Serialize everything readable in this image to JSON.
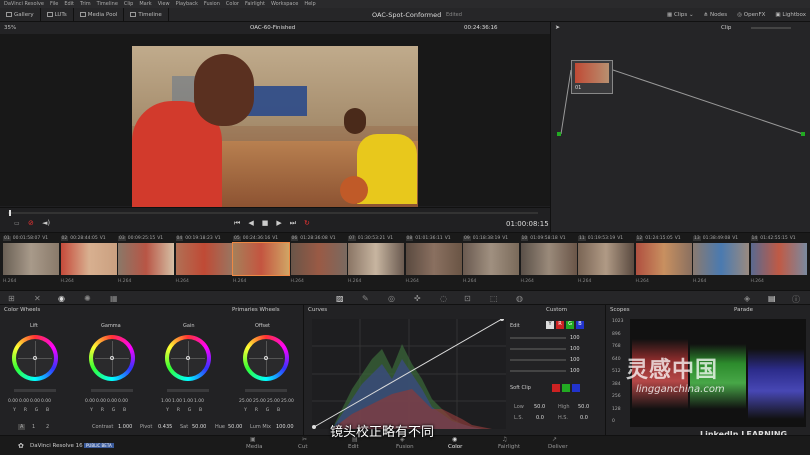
{
  "menu": [
    "DaVinci Resolve",
    "File",
    "Edit",
    "Trim",
    "Timeline",
    "Clip",
    "Mark",
    "View",
    "Playback",
    "Fusion",
    "Color",
    "Fairlight",
    "Workspace",
    "Help"
  ],
  "toolbar": {
    "gallery": "Gallery",
    "luts": "LUTs",
    "media_pool": "Media Pool",
    "timeline": "Timeline",
    "project_title": "OAC-Spot-Conformed",
    "edited": "Edited",
    "clips": "Clips",
    "nodes": "Nodes",
    "openfx": "OpenFX",
    "lightbox": "Lightbox"
  },
  "viewer": {
    "zoom": "35%",
    "clip_name": "OAC-60-Finished",
    "timecode_top": "00:24:36:16",
    "timecode": "01:00:08:15",
    "clip_mode": "Clip"
  },
  "node": {
    "label": "01"
  },
  "clips": [
    {
      "num": "01",
      "tc": "00:01:58:07",
      "track": "V1",
      "codec": "H.264",
      "bg": "linear-gradient(90deg,#6a6055,#a89a8a,#8a7a6a)"
    },
    {
      "num": "02",
      "tc": "00:28:44:05",
      "track": "V1",
      "codec": "H.264",
      "bg": "linear-gradient(90deg,#c54a3a,#d8b090,#caa080)"
    },
    {
      "num": "03",
      "tc": "00:09:25:15",
      "track": "V1",
      "codec": "H.264",
      "bg": "linear-gradient(90deg,#8a7868,#b85545,#d5c0a5)"
    },
    {
      "num": "04",
      "tc": "00:19:18:23",
      "track": "V1",
      "codec": "H.264",
      "bg": "linear-gradient(90deg,#b07055,#c04a35,#9a7560)"
    },
    {
      "num": "05",
      "tc": "00:24:36:16",
      "track": "V1",
      "codec": "H.264",
      "bg": "linear-gradient(90deg,#a5805a,#c45540,#d0a565)"
    },
    {
      "num": "06",
      "tc": "01:28:36:08",
      "track": "V1",
      "codec": "H.264",
      "bg": "linear-gradient(90deg,#6a5548,#9a5a45,#7a6a60)"
    },
    {
      "num": "07",
      "tc": "01:30:53:21",
      "track": "V1",
      "codec": "H.264",
      "bg": "linear-gradient(90deg,#8a7565,#c7b5a0,#6a5a50)"
    },
    {
      "num": "08",
      "tc": "01:01:36:11",
      "track": "V1",
      "codec": "H.264",
      "bg": "linear-gradient(90deg,#5a4a40,#8a7060,#6a5545)"
    },
    {
      "num": "09",
      "tc": "01:18:38:19",
      "track": "V1",
      "codec": "H.264",
      "bg": "linear-gradient(90deg,#6a5a50,#a09080,#7a6a5a)"
    },
    {
      "num": "10",
      "tc": "01:09:58:18",
      "track": "V1",
      "codec": "H.264",
      "bg": "linear-gradient(90deg,#5a5048,#9a8a7a,#6a5548)"
    },
    {
      "num": "11",
      "tc": "01:19:53:19",
      "track": "V1",
      "codec": "H.264",
      "bg": "linear-gradient(90deg,#7a6555,#b09a85,#5a4a40)"
    },
    {
      "num": "12",
      "tc": "01:24:15:05",
      "track": "V1",
      "codec": "H.264",
      "bg": "linear-gradient(90deg,#b05040,#c89060,#8a7060)"
    },
    {
      "num": "13",
      "tc": "01:38:49:08",
      "track": "V1",
      "codec": "H.264",
      "bg": "linear-gradient(90deg,#8a7a70,#4a7ab0,#9a8a80)"
    },
    {
      "num": "14",
      "tc": "01:42:55:15",
      "track": "V1",
      "codec": "H.264",
      "bg": "linear-gradient(90deg,#5a6a90,#c05a45,#7a8aa0)"
    }
  ],
  "color_wheels": {
    "title": "Color Wheels",
    "mode": "Primaries Wheels",
    "wheels": [
      {
        "name": "Lift",
        "vals": [
          "0.00",
          "0.00",
          "0.00",
          "0.00"
        ]
      },
      {
        "name": "Gamma",
        "vals": [
          "0.00",
          "0.00",
          "0.00",
          "0.00"
        ]
      },
      {
        "name": "Gain",
        "vals": [
          "1.00",
          "1.00",
          "1.00",
          "1.00"
        ]
      },
      {
        "name": "Offset",
        "vals": [
          "25.00",
          "25.00",
          "25.00",
          "25.00"
        ]
      }
    ],
    "channels": [
      "Y",
      "R",
      "G",
      "B"
    ],
    "contrast_label": "Contrast",
    "contrast": "1.000",
    "pivot_label": "Pivot",
    "pivot": "0.435",
    "sat_label": "Sat",
    "sat": "50.00",
    "hue_label": "Hue",
    "hue": "50.00",
    "lummix_label": "Lum Mix",
    "lummix": "100.00",
    "page_a": "A",
    "page_1": "1",
    "page_2": "2"
  },
  "curves": {
    "title": "Curves",
    "mode": "Custom",
    "edit": "Edit",
    "vals": [
      "100",
      "100",
      "100",
      "100"
    ],
    "soft_clip": "Soft Clip",
    "low_label": "Low",
    "low": "50.0",
    "high_label": "High",
    "high": "50.0",
    "ls_label": "L.S.",
    "ls": "0.0",
    "hs_label": "H.S.",
    "hs": "0.0"
  },
  "scopes": {
    "title": "Scopes",
    "mode": "Parade",
    "ticks": [
      "1023",
      "896",
      "768",
      "640",
      "512",
      "384",
      "256",
      "128",
      "0"
    ]
  },
  "pages": [
    "Media",
    "Cut",
    "Edit",
    "Fusion",
    "Color",
    "Fairlight",
    "Deliver"
  ],
  "app": {
    "name": "DaVinci Resolve 16",
    "badge": "PUBLIC BETA"
  },
  "subtitle": "镜头校正略有不同",
  "watermark": {
    "cn": "灵感中国",
    "url": "lingganchina.com",
    "li": "LinkedIn LEARNING"
  }
}
